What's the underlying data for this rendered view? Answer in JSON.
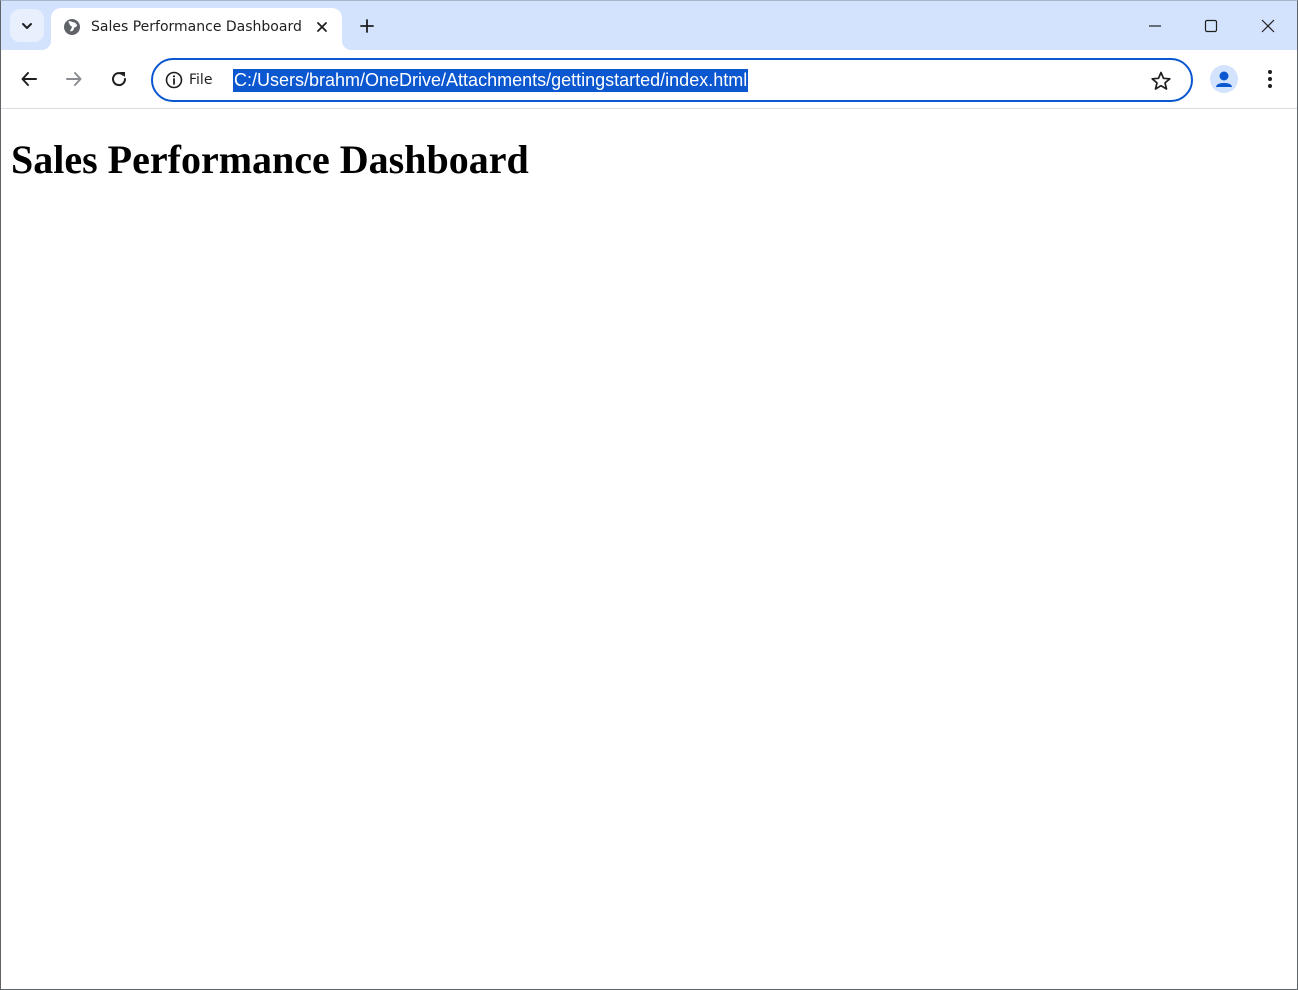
{
  "browser": {
    "tab": {
      "title": "Sales Performance Dashboard",
      "favicon": "globe-icon"
    },
    "address_bar": {
      "site_info_label": "File",
      "url": "C:/Users/brahm/OneDrive/Attachments/gettingstarted/index.html"
    },
    "colors": {
      "tabstrip": "#d3e3fd",
      "accent": "#0b57d0",
      "selection": "#0b57d0"
    },
    "icons": {
      "tab_search": "chevron-down-icon",
      "close_tab": "close-icon",
      "new_tab": "plus-icon",
      "minimize": "minimize-icon",
      "maximize": "maximize-icon",
      "close_window": "close-icon",
      "back": "arrow-left-icon",
      "forward": "arrow-right-icon",
      "reload": "reload-icon",
      "site_info": "info-icon",
      "bookmark": "star-icon",
      "profile": "person-icon",
      "menu": "kebab-menu-icon"
    }
  },
  "page": {
    "heading": "Sales Performance Dashboard"
  }
}
